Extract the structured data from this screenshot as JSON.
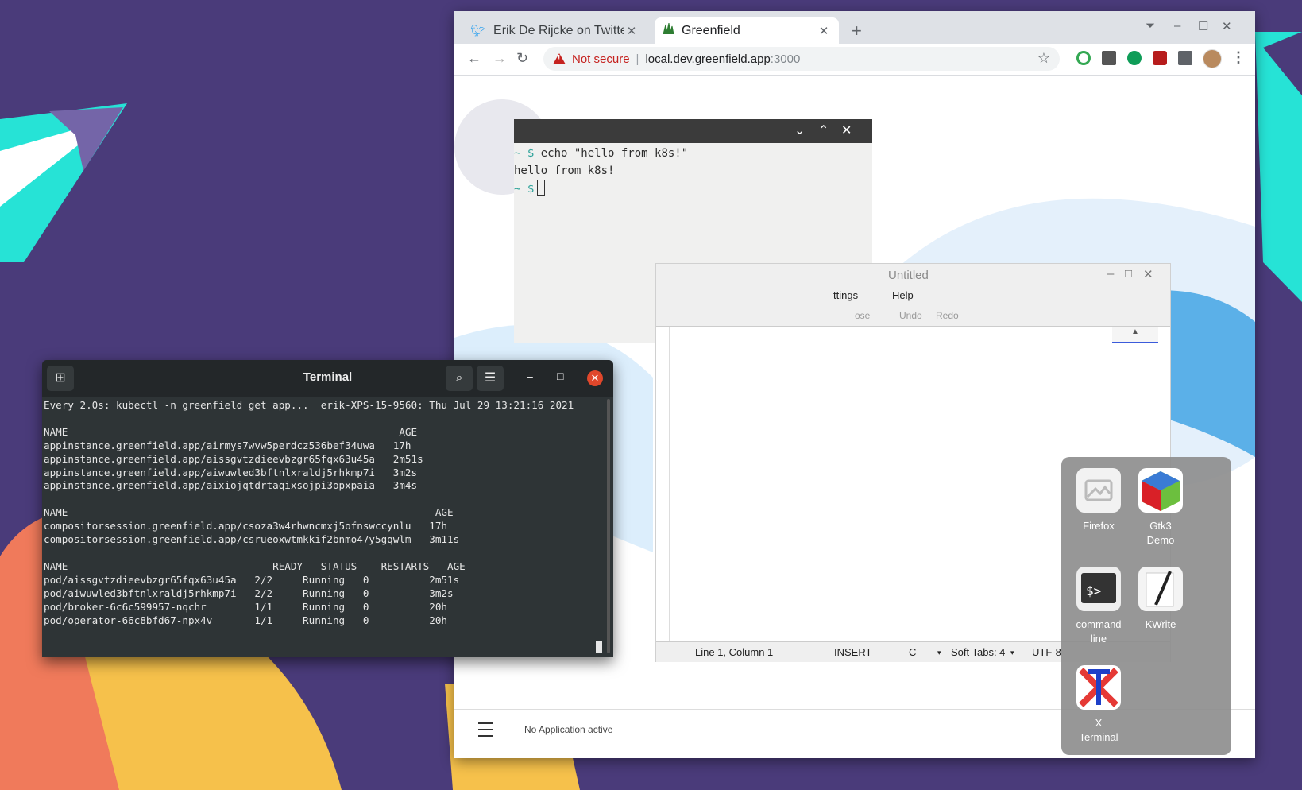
{
  "browser": {
    "tabs": [
      {
        "title": "Erik De Rijcke on Twitte",
        "active": false,
        "icon": "twitter-icon"
      },
      {
        "title": "Greenfield",
        "active": true,
        "icon": "greenfield-icon"
      }
    ],
    "new_tab": "+",
    "not_secure": "Not secure",
    "url_host": "local.dev.greenfield.app",
    "url_port": ":3000",
    "win_controls": {
      "minimize": "–",
      "maximize": "☐",
      "close": "✕"
    }
  },
  "web_terminal": {
    "lines": [
      {
        "prompt": "~ $",
        "text": " echo \"hello from k8s!\""
      },
      {
        "prompt": "",
        "text": "hello from k8s!"
      },
      {
        "prompt": "~ $",
        "text": " "
      }
    ]
  },
  "kwrite": {
    "title": "Untitled",
    "menu": {
      "settings": "ttings",
      "help": "Help"
    },
    "toolbar": {
      "close": "ose",
      "undo": "Undo",
      "redo": "Redo"
    },
    "status": {
      "position": "Line 1, Column 1",
      "mode": "INSERT",
      "language": "C",
      "tabs": "Soft Tabs: 4",
      "encoding": "UTF-8"
    }
  },
  "app_bar": {
    "status": "No Application active"
  },
  "launcher": {
    "apps": [
      {
        "label": "Firefox",
        "icon": "firefox-icon"
      },
      {
        "label": "Gtk3\nDemo",
        "icon": "gtk-icon"
      },
      {
        "label": "command\nline",
        "icon": "terminal-icon"
      },
      {
        "label": "KWrite",
        "icon": "kwrite-icon"
      },
      {
        "label": "X\nTerminal",
        "icon": "xterm-icon"
      }
    ]
  },
  "gnome_terminal": {
    "title": "Terminal",
    "output": "Every 2.0s: kubectl -n greenfield get app...  erik-XPS-15-9560: Thu Jul 29 13:21:16 2021\n\nNAME                                                       AGE\nappinstance.greenfield.app/airmys7wvw5perdcz536bef34uwa   17h\nappinstance.greenfield.app/aissgvtzdieevbzgr65fqx63u45a   2m51s\nappinstance.greenfield.app/aiwuwled3bftnlxraldj5rhkmp7i   3m2s\nappinstance.greenfield.app/aixiojqtdrtaqixsojpi3opxpaia   3m4s\n\nNAME                                                             AGE\ncompositorsession.greenfield.app/csoza3w4rhwncmxj5ofnswccynlu   17h\ncompositorsession.greenfield.app/csrueoxwtmkkif2bnmo47y5gqwlm   3m11s\n\nNAME                                  READY   STATUS    RESTARTS   AGE\npod/aissgvtzdieevbzgr65fqx63u45a   2/2     Running   0          2m51s\npod/aiwuwled3bftnlxraldj5rhkmp7i   2/2     Running   0          3m2s\npod/broker-6c6c599957-nqchr        1/1     Running   0          20h\npod/operator-66c8bfd67-npx4v       1/1     Running   0          20h"
  }
}
